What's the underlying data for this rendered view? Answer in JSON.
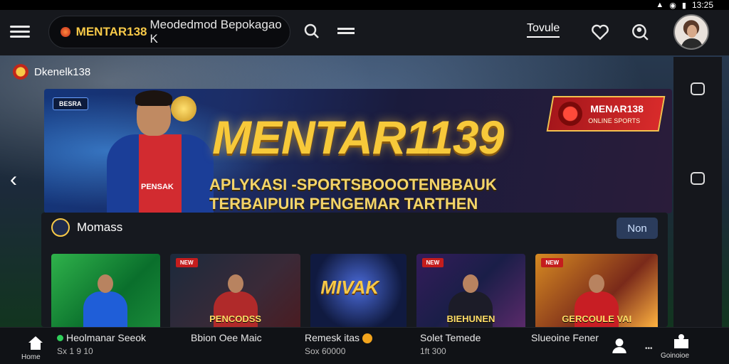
{
  "status_bar": {
    "time": "13:25"
  },
  "header": {
    "search_brand": "MENTAR138",
    "search_text": "Meodedmod Bepokagao K",
    "link": "Tovule"
  },
  "breadcrumb": {
    "label": "Dkenelk138"
  },
  "banner": {
    "badge": "BESRA",
    "player_shirt": "PENSAK",
    "title": "MENTAR1139",
    "subtitle_line1": "APLYKASI -SPORTSBOOOTENBBAUK",
    "subtitle_line2": "TERBAIPUIR PENGEMAR TARTHEN",
    "brand_name": "MENAR138",
    "brand_sub": "ONLINE SPORTS"
  },
  "games": {
    "title": "Momass",
    "more_label": "Non",
    "cards": [
      {
        "tag": "",
        "caption": ""
      },
      {
        "tag": "NEW",
        "caption": "PENCODSS"
      },
      {
        "tag": "",
        "caption": "",
        "logo": "MIVAK"
      },
      {
        "tag": "NEW",
        "caption": "BIEHUNEN"
      },
      {
        "tag": "NEW",
        "caption": "GERCOULE VAI"
      }
    ]
  },
  "bottom_nav": {
    "home_label": "Home",
    "item1_title": "Heolmanar Seeok",
    "item1_sub": "Sx 1 9 10",
    "item2_title": "Bbion Oee Maic",
    "item3_title": "Remesk itas",
    "item3_sub": "Sox 60000",
    "item4_title": "Solet Temede",
    "item4_sub": "1ft 300",
    "item5_title": "Slueoine Fener",
    "extra_label": "Goinoioe"
  }
}
